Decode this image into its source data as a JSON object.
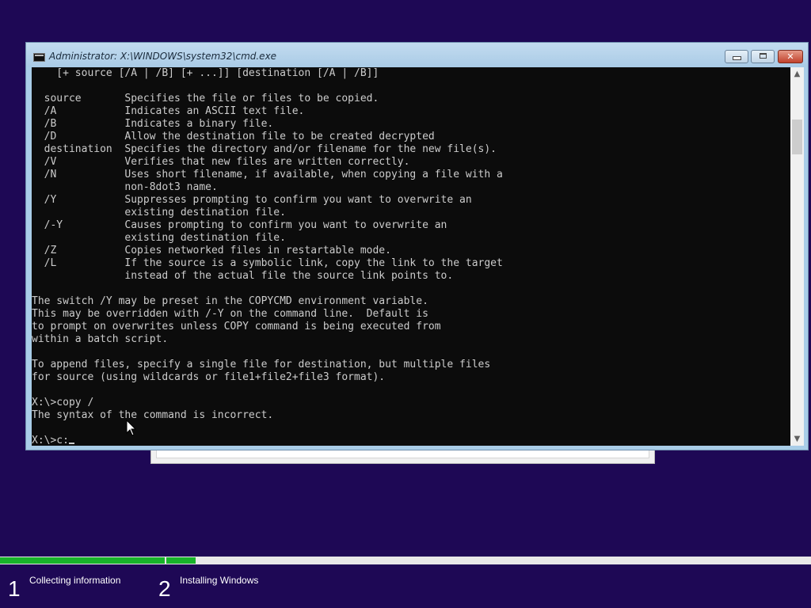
{
  "window": {
    "title": "Administrator: X:\\WINDOWS\\system32\\cmd.exe",
    "minimize_glyph": "",
    "maximize_glyph": "",
    "close_glyph": "✕"
  },
  "console": {
    "lines": [
      "    [+ source [/A | /B] [+ ...]] [destination [/A | /B]]",
      "",
      "  source       Specifies the file or files to be copied.",
      "  /A           Indicates an ASCII text file.",
      "  /B           Indicates a binary file.",
      "  /D           Allow the destination file to be created decrypted",
      "  destination  Specifies the directory and/or filename for the new file(s).",
      "  /V           Verifies that new files are written correctly.",
      "  /N           Uses short filename, if available, when copying a file with a",
      "               non-8dot3 name.",
      "  /Y           Suppresses prompting to confirm you want to overwrite an",
      "               existing destination file.",
      "  /-Y          Causes prompting to confirm you want to overwrite an",
      "               existing destination file.",
      "  /Z           Copies networked files in restartable mode.",
      "  /L           If the source is a symbolic link, copy the link to the target",
      "               instead of the actual file the source link points to.",
      "",
      "The switch /Y may be preset in the COPYCMD environment variable.",
      "This may be overridden with /-Y on the command line.  Default is",
      "to prompt on overwrites unless COPY command is being executed from",
      "within a batch script.",
      "",
      "To append files, specify a single file for destination, but multiple files",
      "for source (using wildcards or file1+file2+file3 format).",
      "",
      "X:\\>copy /",
      "The syntax of the command is incorrect.",
      ""
    ],
    "prompt_line": "X:\\>c:"
  },
  "setup": {
    "step1": {
      "number": "1",
      "label": "Collecting information",
      "progress": 1.0
    },
    "step2": {
      "number": "2",
      "label": "Installing Windows",
      "progress": 0.045
    }
  },
  "colors": {
    "desktop": "#1e0855",
    "progress_fill": "#18b32a",
    "console_bg": "#0c0c0c",
    "console_fg": "#cccccc"
  },
  "icons": {
    "window_icon": "cmd-icon",
    "scroll_up": "▲",
    "scroll_down": "▼"
  }
}
